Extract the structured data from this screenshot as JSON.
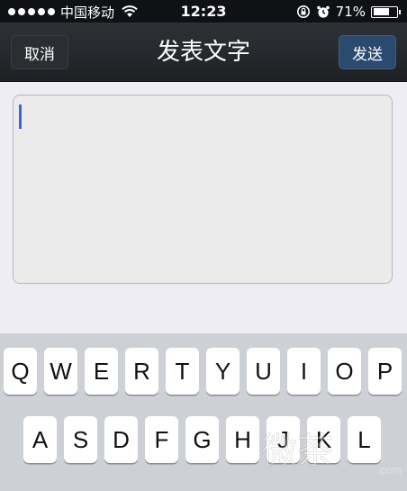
{
  "status_bar": {
    "carrier": "中国移动",
    "time": "12:23",
    "battery": "71%",
    "battery_level": 0.71
  },
  "nav": {
    "cancel_label": "取消",
    "title": "发表文字",
    "send_label": "发送"
  },
  "compose": {
    "value": ""
  },
  "keyboard": {
    "row1": [
      "Q",
      "W",
      "E",
      "R",
      "T",
      "Y",
      "U",
      "I",
      "O",
      "P"
    ],
    "row2": [
      "A",
      "S",
      "D",
      "F",
      "G",
      "H",
      "J",
      "K",
      "L"
    ]
  },
  "watermark": {
    "logo_text": "微茶",
    "url": ".com"
  },
  "colors": {
    "caret": "#3a66d9",
    "send_button": "#2b4a6f",
    "nav_background": "#1e2124"
  }
}
